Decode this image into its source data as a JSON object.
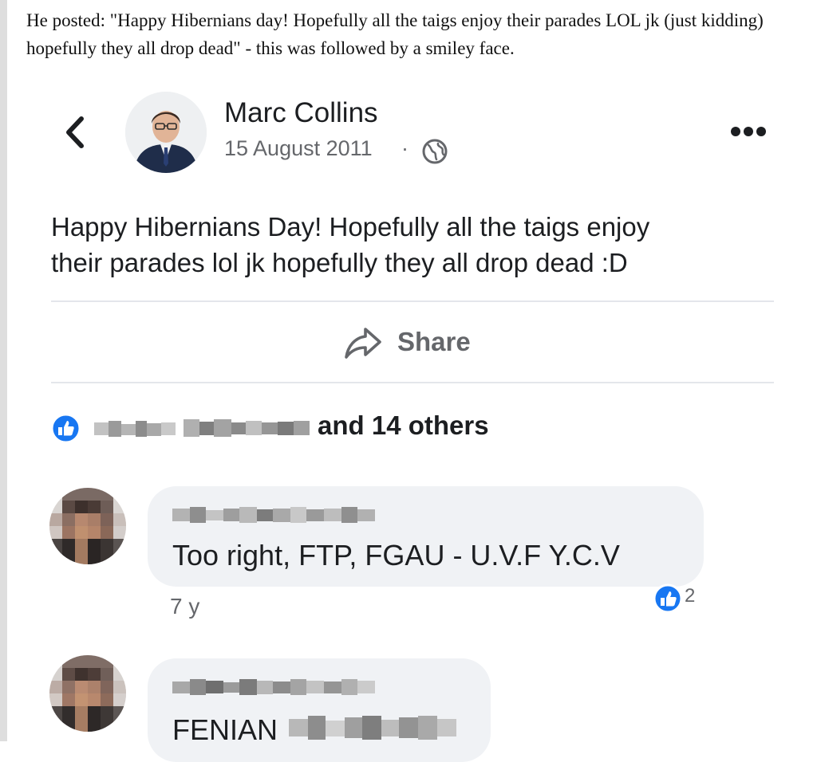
{
  "caption": "He posted: \"Happy Hibernians day! Hopefully all the taigs enjoy their parades LOL jk (just kidding) hopefully they all drop dead\" - this was followed by a smiley face.",
  "post": {
    "author_name": "Marc Collins",
    "date": "15 August 2011",
    "separator": "·",
    "text_line1": "Happy Hibernians Day! Hopefully all the taigs enjoy",
    "text_line2": "their parades lol jk hopefully they all drop dead :D",
    "share_label": "Share",
    "likes_suffix": "and 14 others",
    "icons": {
      "back": "chevron-left-icon",
      "privacy": "globe-icon",
      "more": "more-options-icon",
      "share": "share-arrow-icon",
      "like": "thumbs-up-icon"
    }
  },
  "comments": [
    {
      "text": "Too right, FTP, FGAU - U.V.F  Y.C.V",
      "time": "7 y",
      "reaction_count": "2"
    },
    {
      "text": "FENIAN"
    }
  ],
  "colors": {
    "facebook_blue": "#1877f2",
    "secondary_text": "#65676b",
    "bubble_bg": "#f0f2f5"
  }
}
